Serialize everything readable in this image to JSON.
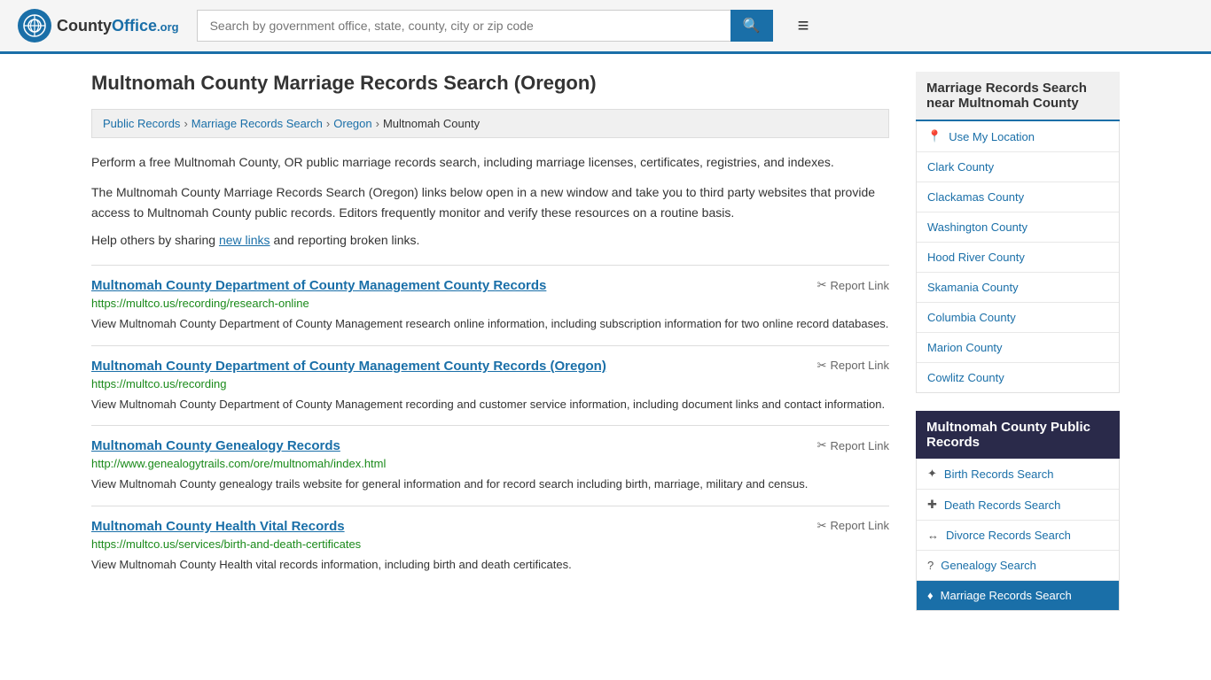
{
  "header": {
    "logo_text": "CountyOffice",
    "logo_org": ".org",
    "search_placeholder": "Search by government office, state, county, city or zip code",
    "search_icon": "🔍",
    "menu_icon": "≡"
  },
  "page": {
    "title": "Multnomah County Marriage Records Search (Oregon)"
  },
  "breadcrumb": {
    "items": [
      "Public Records",
      "Marriage Records Search",
      "Oregon",
      "Multnomah County"
    ]
  },
  "description": {
    "paragraph1": "Perform a free Multnomah County, OR public marriage records search, including marriage licenses, certificates, registries, and indexes.",
    "paragraph2": "The Multnomah County Marriage Records Search (Oregon) links below open in a new window and take you to third party websites that provide access to Multnomah County public records. Editors frequently monitor and verify these resources on a routine basis.",
    "help_text_prefix": "Help others by sharing ",
    "help_link": "new links",
    "help_text_suffix": " and reporting broken links."
  },
  "results": [
    {
      "title": "Multnomah County Department of County Management County Records",
      "url": "https://multco.us/recording/research-online",
      "desc": "View Multnomah County Department of County Management research online information, including subscription information for two online record databases.",
      "report": "Report Link"
    },
    {
      "title": "Multnomah County Department of County Management County Records (Oregon)",
      "url": "https://multco.us/recording",
      "desc": "View Multnomah County Department of County Management recording and customer service information, including document links and contact information.",
      "report": "Report Link"
    },
    {
      "title": "Multnomah County Genealogy Records",
      "url": "http://www.genealogytrails.com/ore/multnomah/index.html",
      "desc": "View Multnomah County genealogy trails website for general information and for record search including birth, marriage, military and census.",
      "report": "Report Link"
    },
    {
      "title": "Multnomah County Health Vital Records",
      "url": "https://multco.us/services/birth-and-death-certificates",
      "desc": "View Multnomah County Health vital records information, including birth and death certificates.",
      "report": "Report Link"
    }
  ],
  "sidebar": {
    "nearby_title": "Marriage Records Search near Multnomah County",
    "use_my_location": "Use My Location",
    "nearby_counties": [
      "Clark County",
      "Clackamas County",
      "Washington County",
      "Hood River County",
      "Skamania County",
      "Columbia County",
      "Marion County",
      "Cowlitz County"
    ],
    "public_records_title": "Multnomah County Public Records",
    "public_records_links": [
      {
        "icon": "✦",
        "label": "Birth Records Search"
      },
      {
        "icon": "+",
        "label": "Death Records Search"
      },
      {
        "icon": "↔",
        "label": "Divorce Records Search"
      },
      {
        "icon": "?",
        "label": "Genealogy Search"
      },
      {
        "icon": "♦",
        "label": "Marriage Records Search"
      }
    ]
  }
}
